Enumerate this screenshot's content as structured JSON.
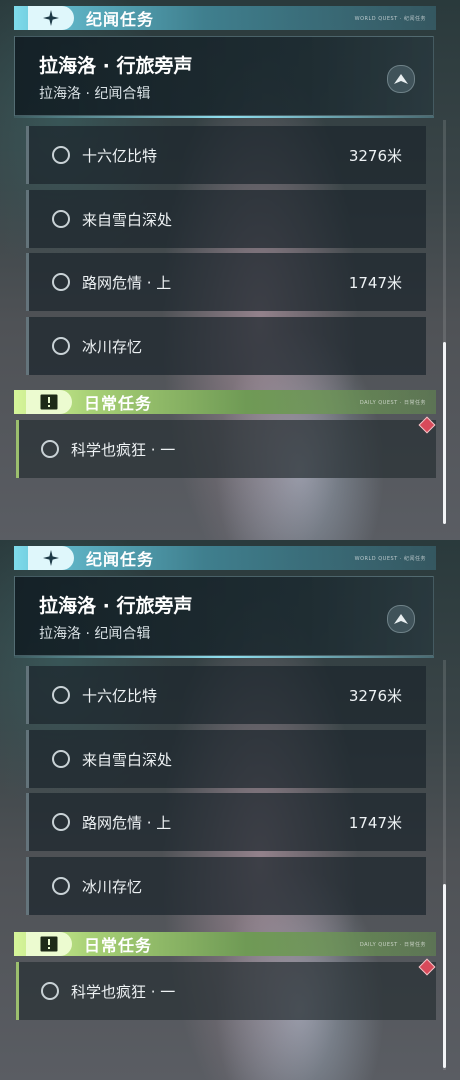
{
  "panels": [
    {
      "world_section": {
        "title": "纪闻任务",
        "deco": "WORLD QUEST · 纪闻任务"
      },
      "quest": {
        "title": "拉海洛 · 行旅旁声",
        "subtitle": "拉海洛 · 纪闻合辑"
      },
      "tasks": [
        {
          "label": "十六亿比特",
          "distance": "3276米"
        },
        {
          "label": "来自雪白深处",
          "distance": ""
        },
        {
          "label": "路网危情 · 上",
          "distance": "1747米"
        },
        {
          "label": "冰川存忆",
          "distance": ""
        }
      ],
      "daily_section": {
        "title": "日常任务",
        "deco": "DAILY QUEST · 日常任务"
      },
      "daily_tasks": [
        {
          "label": "科学也疯狂 · 一"
        }
      ]
    },
    {
      "world_section": {
        "title": "纪闻任务",
        "deco": "WORLD QUEST · 纪闻任务"
      },
      "quest": {
        "title": "拉海洛 · 行旅旁声",
        "subtitle": "拉海洛 · 纪闻合辑"
      },
      "tasks": [
        {
          "label": "十六亿比特",
          "distance": "3276米"
        },
        {
          "label": "来自雪白深处",
          "distance": ""
        },
        {
          "label": "路网危情 · 上",
          "distance": "1747米"
        },
        {
          "label": "冰川存忆",
          "distance": ""
        }
      ],
      "daily_section": {
        "title": "日常任务",
        "deco": "DAILY QUEST · 日常任务"
      },
      "daily_tasks": [
        {
          "label": "科学也疯狂 · 一"
        }
      ]
    }
  ],
  "icons": {
    "world_section": "sparkle-icon",
    "quest_button": "navigate-arrow-icon",
    "daily_section": "exclamation-icon",
    "task_status": "circle-icon",
    "alert": "diamond-alert-icon"
  },
  "colors": {
    "world_accent": "#7fdcec",
    "daily_accent": "#d6f59a",
    "alert": "#d84a5a"
  }
}
